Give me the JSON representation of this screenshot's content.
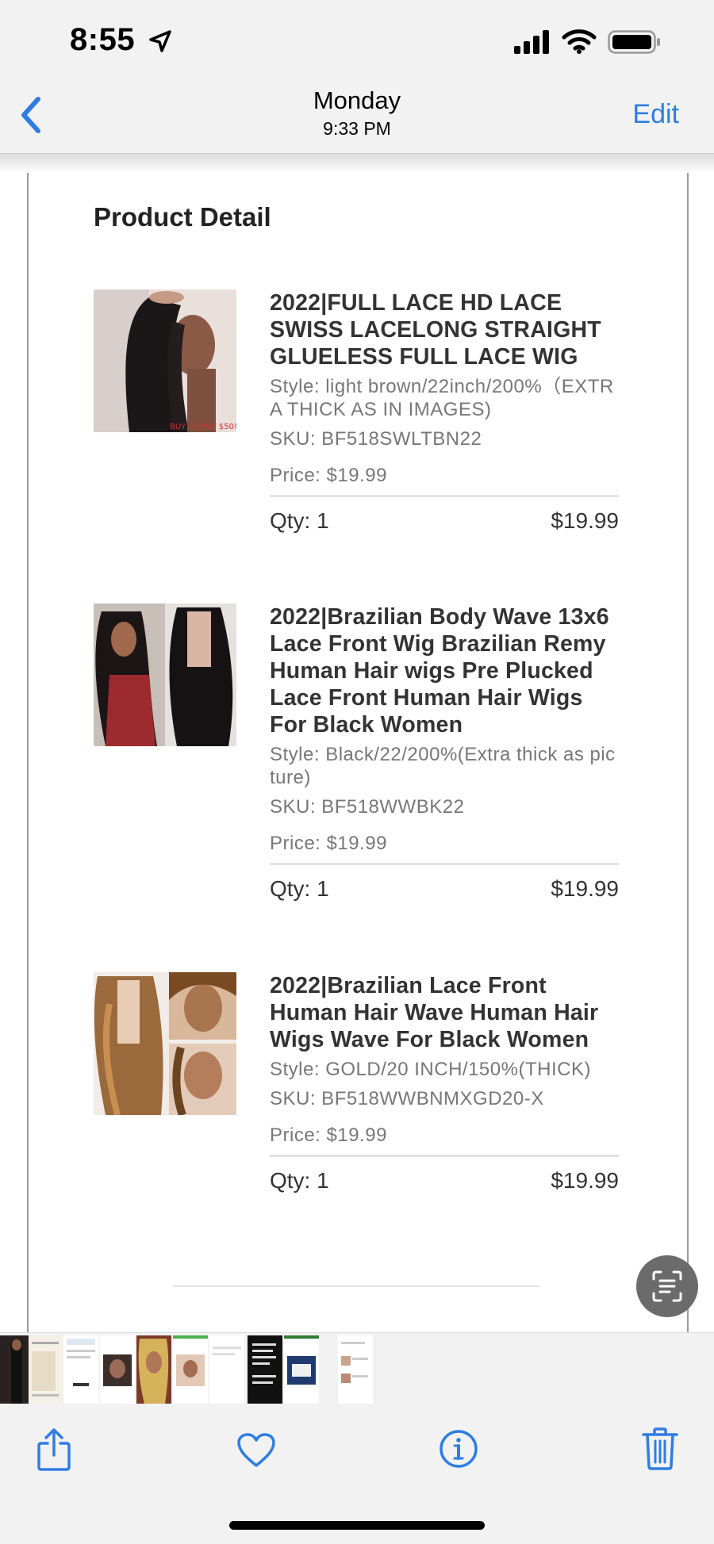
{
  "status_bar": {
    "time": "8:55",
    "icons": [
      "location-arrow-icon",
      "cellular-signal-icon",
      "wifi-icon",
      "battery-icon"
    ]
  },
  "nav": {
    "back_icon": "chevron-left-icon",
    "title": "Monday",
    "subtitle": "9:33 PM",
    "edit_label": "Edit",
    "accent_color": "#2f7de1"
  },
  "document": {
    "heading": "Product Detail",
    "products": [
      {
        "title": "2022|FULL LACE HD LACE SWISS LACELONG STRAIGHT GLUELESS FULL LACE WIG",
        "style": "Style: light brown/22inch/200%（EXTRA THICK AS IN IMAGES)",
        "sku": "SKU: BF518SWLTBN22",
        "price": "Price: $19.99",
        "qty": "Qty: 1",
        "total": "$19.99",
        "thumb_overlay": "BUY 4 ONLY $50!!"
      },
      {
        "title": "2022|Brazilian Body Wave 13x6 Lace Front Wig Brazilian Remy Human Hair wigs Pre Plucked Lace Front Human Hair Wigs For Black Women",
        "style": "Style: Black/22/200%(Extra thick as picture)",
        "sku": "SKU: BF518WWBK22",
        "price": "Price: $19.99",
        "qty": "Qty: 1",
        "total": "$19.99"
      },
      {
        "title": "2022|Brazilian Lace Front Human Hair Wave Human Hair Wigs Wave For Black Women",
        "style": "Style: GOLD/20 INCH/150%(THICK)",
        "sku": "SKU: BF518WWBNMXGD20-X",
        "price": "Price: $19.99",
        "qty": "Qty: 1",
        "total": "$19.99"
      }
    ]
  },
  "live_text_icon": "live-text-scan-icon",
  "toolbar": {
    "icons": [
      "share-icon",
      "heart-icon",
      "info-icon",
      "trash-icon"
    ]
  }
}
